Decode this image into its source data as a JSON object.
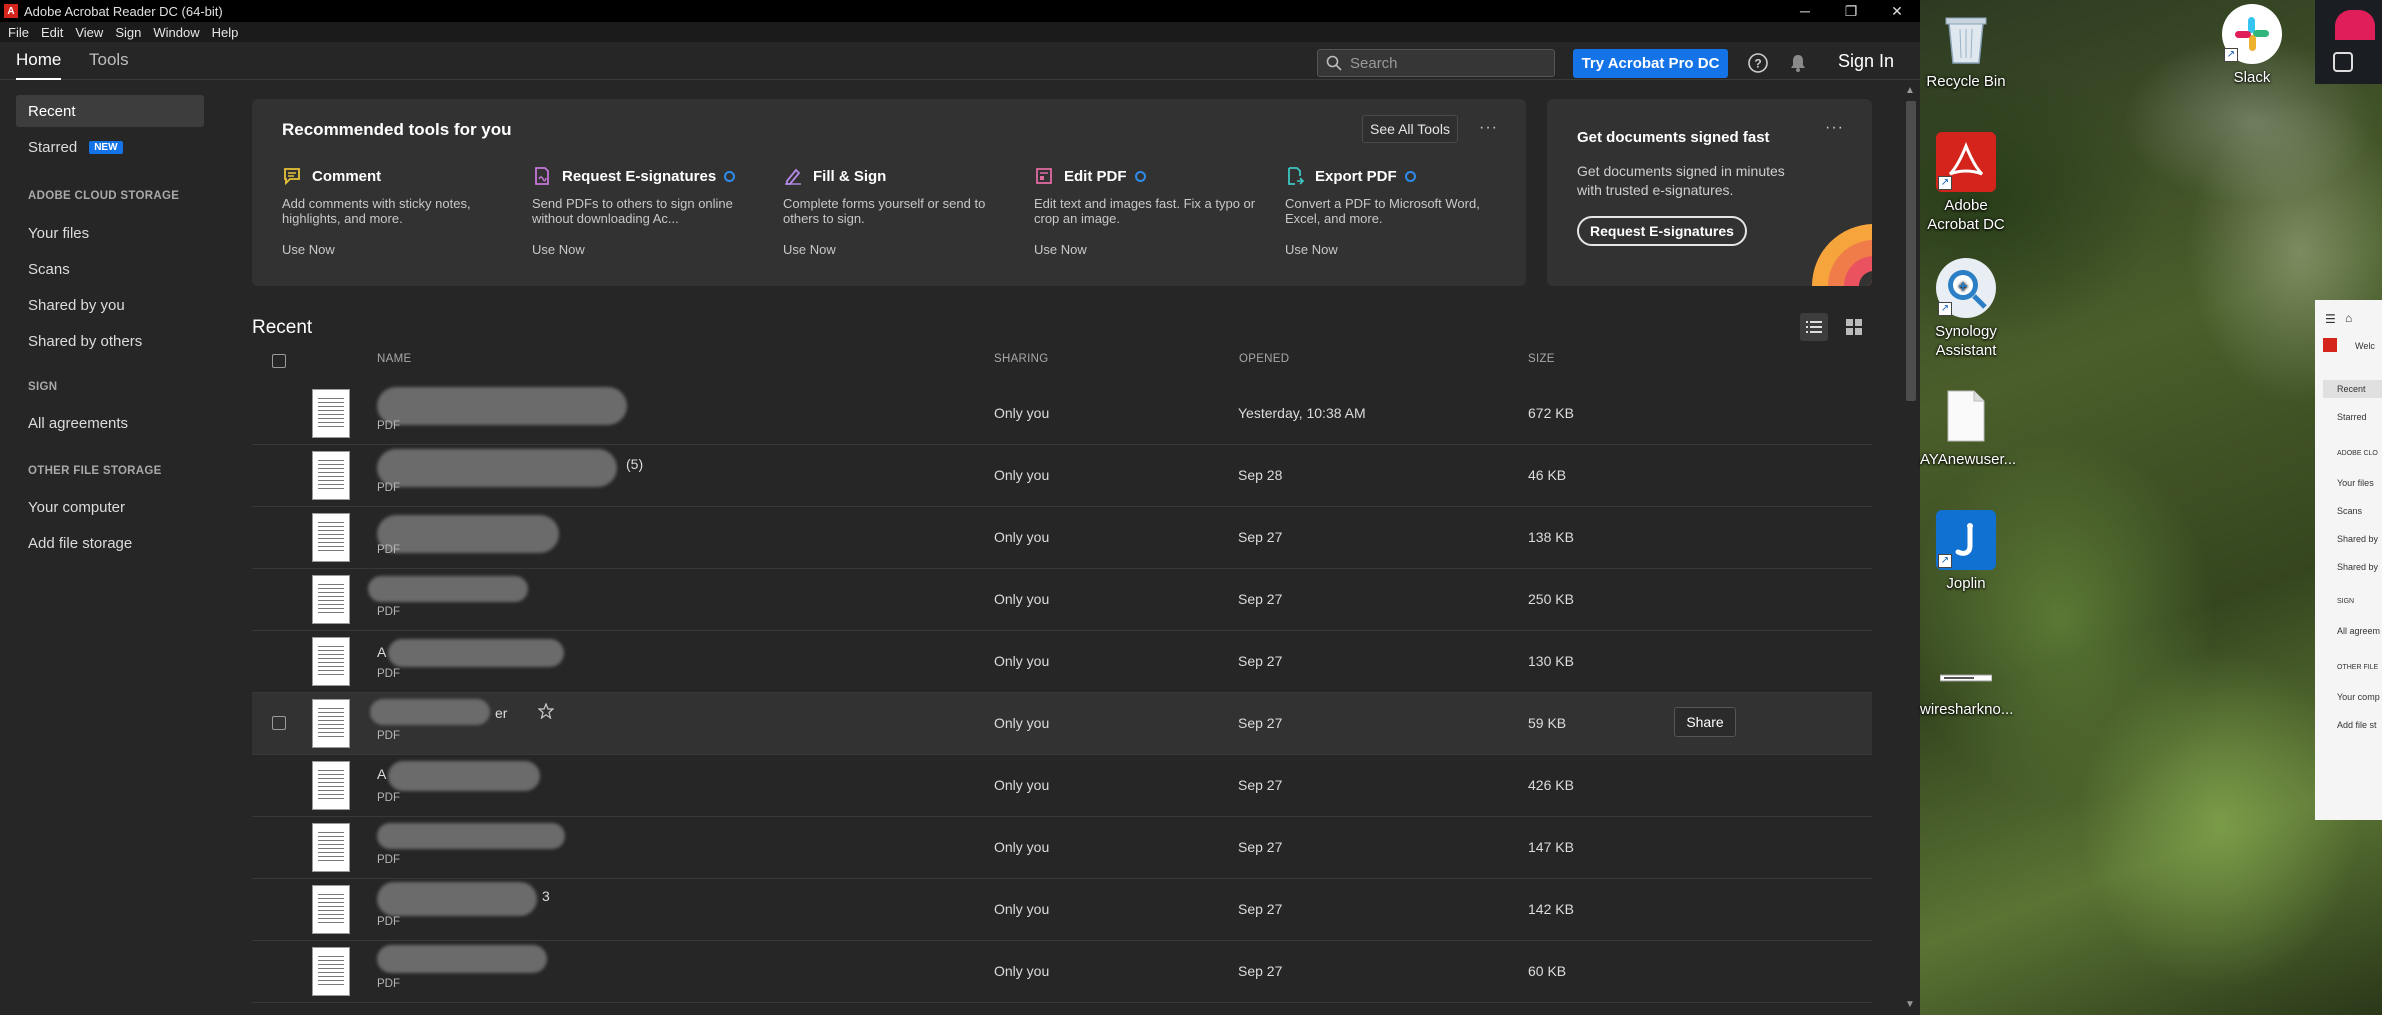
{
  "window": {
    "title": "Adobe Acrobat Reader DC (64-bit)",
    "minimize": "─",
    "restore": "❐",
    "close": "✕"
  },
  "menu": [
    "File",
    "Edit",
    "View",
    "Sign",
    "Window",
    "Help"
  ],
  "toolbar": {
    "tabs": [
      "Home",
      "Tools"
    ],
    "search_placeholder": "Search",
    "try_label": "Try Acrobat Pro DC",
    "sign_in": "Sign In"
  },
  "sidebar": {
    "recent": "Recent",
    "starred": "Starred",
    "new_badge": "NEW",
    "cloud_heading": "ADOBE CLOUD STORAGE",
    "cloud_items": [
      "Your files",
      "Scans",
      "Shared by you",
      "Shared by others"
    ],
    "sign_heading": "SIGN",
    "sign_items": [
      "All agreements"
    ],
    "other_heading": "OTHER FILE STORAGE",
    "other_items": [
      "Your computer",
      "Add file storage"
    ]
  },
  "recommended": {
    "title": "Recommended tools for you",
    "see_all": "See All Tools",
    "more": "···",
    "tools": [
      {
        "name": "Comment",
        "desc": "Add comments with sticky notes, highlights, and more.",
        "use": "Use Now",
        "icon": "comment-icon",
        "color": "#e8c23a",
        "badge": false
      },
      {
        "name": "Request E-signatures",
        "desc": "Send PDFs to others to sign online without downloading Ac...",
        "use": "Use Now",
        "icon": "request-signature-icon",
        "color": "#c576d9",
        "badge": true
      },
      {
        "name": "Fill & Sign",
        "desc": "Complete forms yourself or send to others to sign.",
        "use": "Use Now",
        "icon": "fill-sign-icon",
        "color": "#b48ae6",
        "badge": false
      },
      {
        "name": "Edit PDF",
        "desc": "Edit text and images fast. Fix a typo or crop an image.",
        "use": "Use Now",
        "icon": "edit-pdf-icon",
        "color": "#e06aa0",
        "badge": true
      },
      {
        "name": "Export PDF",
        "desc": "Convert a PDF to Microsoft Word, Excel, and more.",
        "use": "Use Now",
        "icon": "export-pdf-icon",
        "color": "#3cc6c0",
        "badge": true
      }
    ]
  },
  "signed_card": {
    "title": "Get documents signed fast",
    "desc": "Get documents signed in minutes with trusted e-signatures.",
    "button": "Request E-signatures",
    "more": "···"
  },
  "recent": {
    "heading": "Recent",
    "columns": {
      "name": "NAME",
      "sharing": "SHARING",
      "opened": "OPENED",
      "size": "SIZE"
    },
    "share_label": "Share",
    "files": [
      {
        "type": "PDF",
        "sharing": "Only you",
        "opened": "Yesterday, 10:38 AM",
        "size": "672 KB",
        "extra": ""
      },
      {
        "type": "PDF",
        "sharing": "Only you",
        "opened": "Sep 28",
        "size": "46 KB",
        "extra": "(5)"
      },
      {
        "type": "PDF",
        "sharing": "Only you",
        "opened": "Sep 27",
        "size": "138 KB",
        "extra": ""
      },
      {
        "type": "PDF",
        "sharing": "Only you",
        "opened": "Sep 27",
        "size": "250 KB",
        "extra": ""
      },
      {
        "type": "PDF",
        "sharing": "Only you",
        "opened": "Sep 27",
        "size": "130 KB",
        "extra": "A"
      },
      {
        "type": "PDF",
        "sharing": "Only you",
        "opened": "Sep 27",
        "size": "59 KB",
        "extra": "er"
      },
      {
        "type": "PDF",
        "sharing": "Only you",
        "opened": "Sep 27",
        "size": "426 KB",
        "extra": "A"
      },
      {
        "type": "PDF",
        "sharing": "Only you",
        "opened": "Sep 27",
        "size": "147 KB",
        "extra": ""
      },
      {
        "type": "PDF",
        "sharing": "Only you",
        "opened": "Sep 27",
        "size": "142 KB",
        "extra": "3"
      },
      {
        "type": "PDF",
        "sharing": "Only you",
        "opened": "Sep 27",
        "size": "60 KB",
        "extra": ""
      }
    ]
  },
  "desktop": {
    "icons": [
      {
        "label": "Recycle Bin",
        "icon": "recycle-bin-icon"
      },
      {
        "label": "Adobe Acrobat DC",
        "icon": "acrobat-icon"
      },
      {
        "label": "Synology Assistant",
        "icon": "synology-icon"
      },
      {
        "label": "AYAnewuser...",
        "icon": "document-icon"
      },
      {
        "label": "Joplin",
        "icon": "joplin-icon"
      },
      {
        "label": "wiresharkno...",
        "icon": "file-icon"
      },
      {
        "label": "Slack",
        "icon": "slack-icon"
      }
    ]
  },
  "mini_window": {
    "items": [
      "Recent",
      "Starred",
      "ADOBE CLO",
      "Your files",
      "Scans",
      "Shared by",
      "Shared by",
      "SIGN",
      "All agreem",
      "OTHER FILE",
      "Your comp",
      "Add file st"
    ],
    "welcome": "Welc"
  }
}
